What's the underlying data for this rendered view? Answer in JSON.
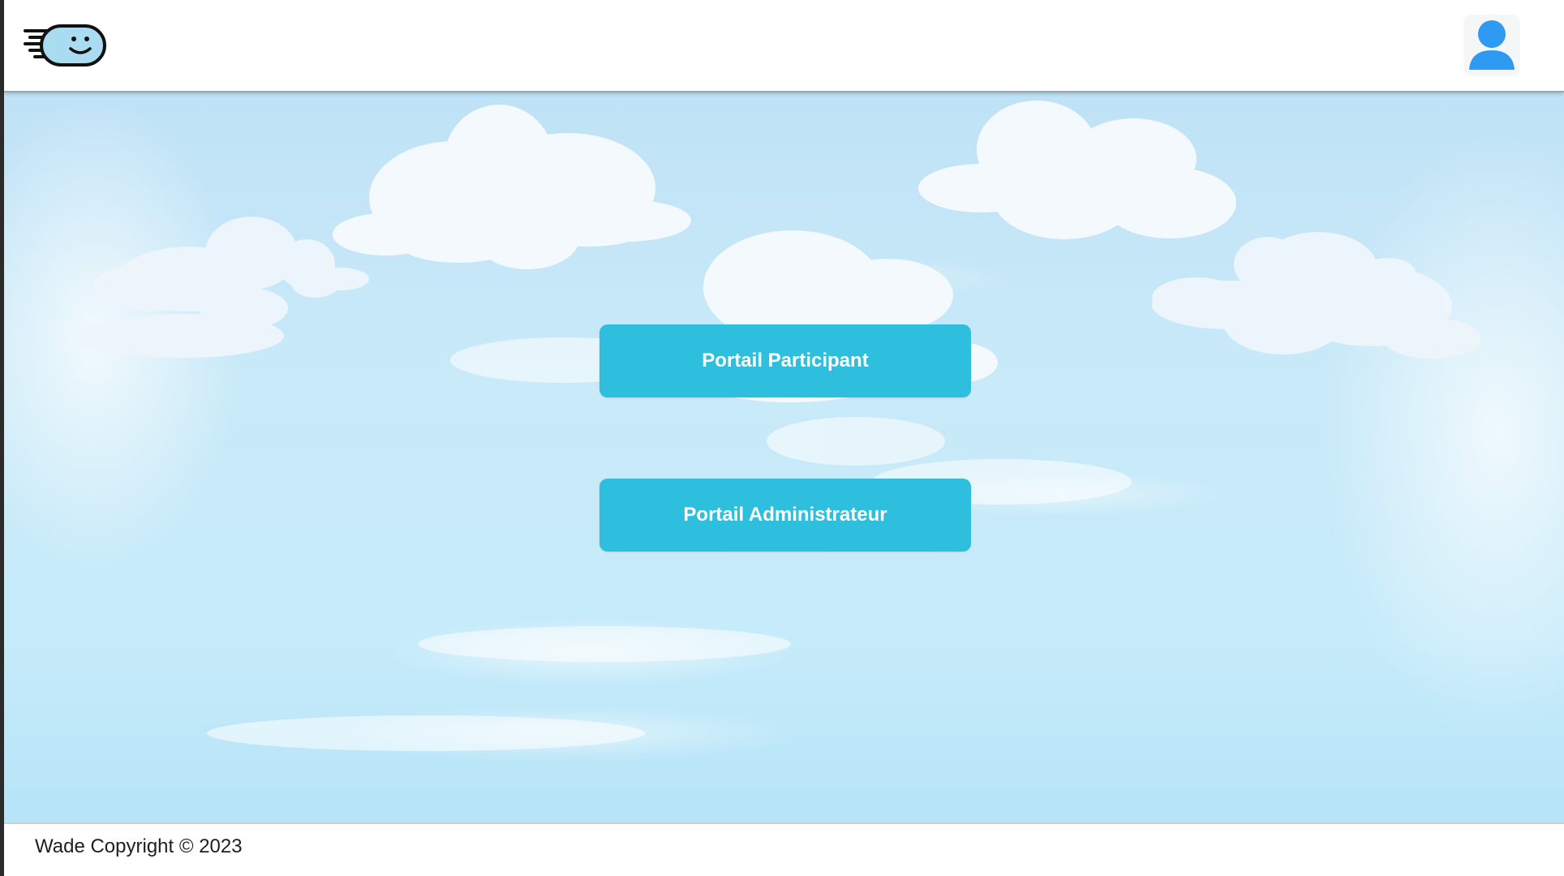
{
  "header": {
    "logo_icon": "smiling-face-speed-logo-icon",
    "profile_icon": "user-profile-icon",
    "profile_icon_color": "#2e9af2"
  },
  "main": {
    "background": "sky-with-clouds",
    "buttons": [
      {
        "label": "Portail Participant",
        "color": "#2ebfdf"
      },
      {
        "label": "Portail Administrateur",
        "color": "#2ebfdf"
      }
    ]
  },
  "footer": {
    "copyright": "Wade Copyright © 2023"
  }
}
